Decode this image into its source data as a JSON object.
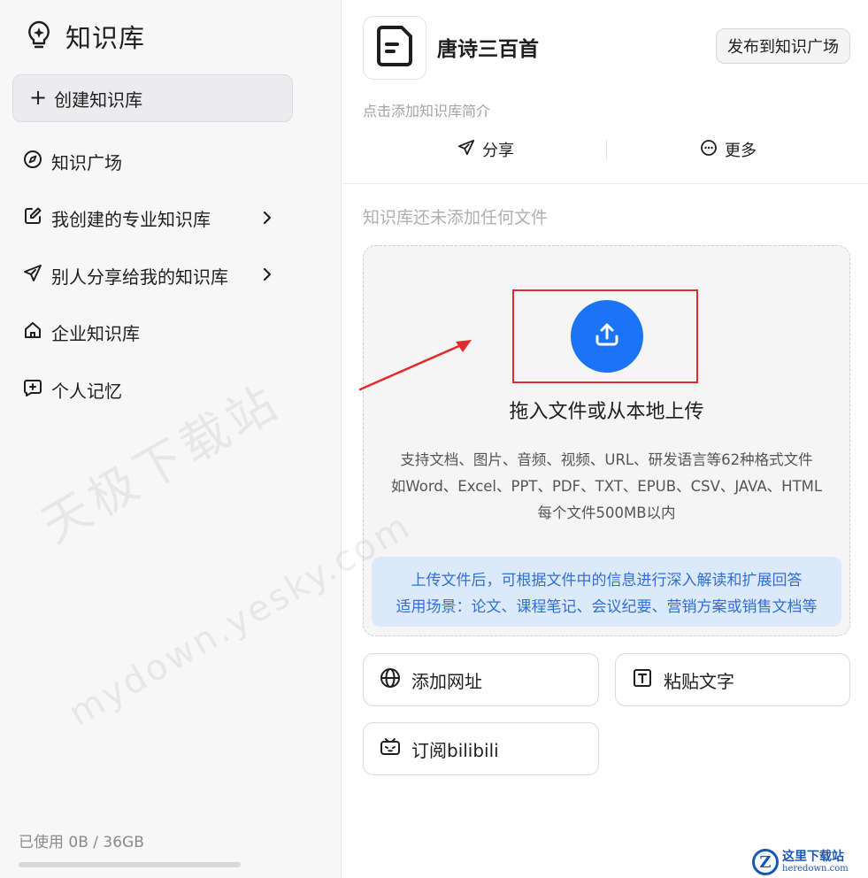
{
  "sidebar": {
    "brand_title": "知识库",
    "create_label": "创建知识库",
    "nav_items": [
      {
        "label": "知识广场",
        "icon": "compass-icon"
      },
      {
        "label": "我创建的专业知识库",
        "icon": "edit-icon",
        "has_chevron": true
      },
      {
        "label": "别人分享给我的知识库",
        "icon": "send-icon",
        "has_chevron": true
      },
      {
        "label": "企业知识库",
        "icon": "home-icon"
      },
      {
        "label": "个人记忆",
        "icon": "chat-plus-icon"
      }
    ],
    "usage_text": "已使用 0B / 36GB",
    "usage_fraction": 0
  },
  "main": {
    "kb_title": "唐诗三百首",
    "publish_label": "发布到知识广场",
    "description_placeholder": "点击添加知识库简介",
    "share_label": "分享",
    "more_label": "更多",
    "empty_hint": "知识库还未添加任何文件",
    "dropzone": {
      "title": "拖入文件或从本地上传",
      "sub_line1": "支持文档、图片、音频、视频、URL、研发语言等62种格式文件",
      "sub_line2": "如Word、Excel、PPT、PDF、TXT、EPUB、CSV、JAVA、HTML",
      "sub_line3": "每个文件500MB以内",
      "info_line1": "上传文件后，可根据文件中的信息进行深入解读和扩展回答",
      "info_line2": "适用场景：论文、课程笔记、会议纪要、营销方案或销售文档等"
    },
    "add_url_label": "添加网址",
    "paste_text_label": "粘贴文字",
    "bilibili_label": "订阅bilibili"
  },
  "overlay": {
    "watermark_line1": "天极下载站",
    "watermark_line2": "mydown.yesky.com",
    "corner_logo_line1": "这里下载站",
    "corner_logo_line2": "heredown.com",
    "corner_logo_letter": "Z"
  },
  "colors": {
    "accent_blue": "#1b74f5",
    "annotation_red": "#e22b2b",
    "info_bg": "#dce9fb",
    "info_text": "#2f6fd8"
  }
}
